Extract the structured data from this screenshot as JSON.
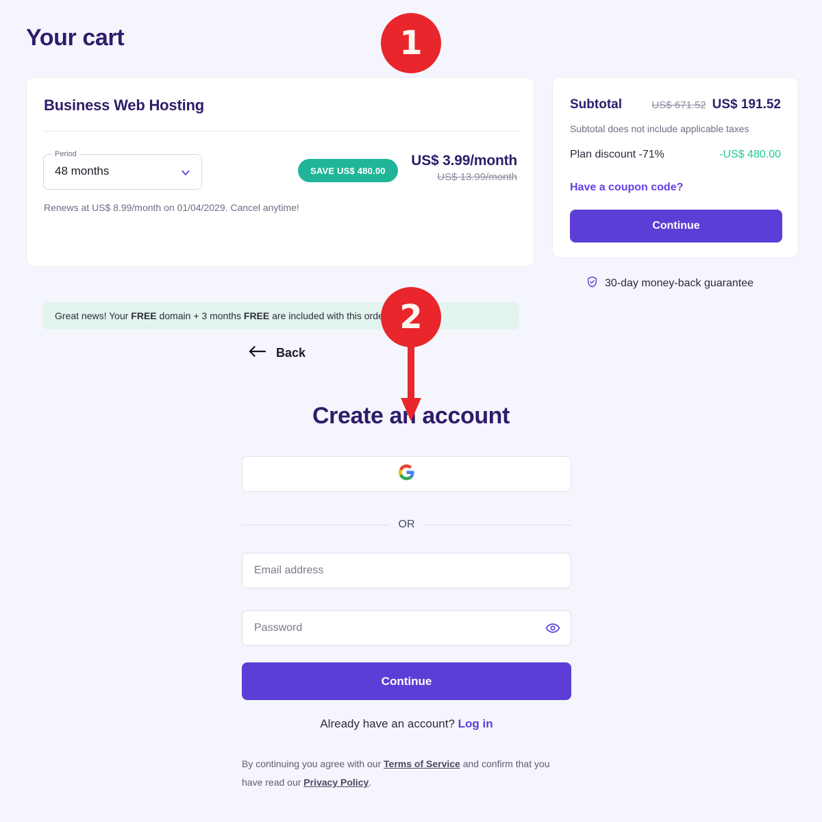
{
  "page": {
    "title": "Your cart",
    "background_color": "#f5f5fd",
    "brand_purple": "#5c3ed6",
    "heading_color": "#2f1c6a",
    "accent_green": "#20b598",
    "marker_red": "#e8262b"
  },
  "annotations": [
    {
      "id": "1",
      "label": "1",
      "shape": "circle"
    },
    {
      "id": "2",
      "label": "2",
      "shape": "circle-with-down-arrow"
    }
  ],
  "cart": {
    "product_title": "Business Web Hosting",
    "period": {
      "legend": "Period",
      "value": "48 months",
      "options": [
        "48 months"
      ]
    },
    "save_badge": "SAVE US$ 480.00",
    "price_now": "US$ 3.99/month",
    "price_old": "US$ 13.99/month",
    "renew_note": "Renews at US$ 8.99/month on 01/04/2029. Cancel anytime!",
    "free_banner": {
      "part1": "Great news! Your ",
      "free1": "FREE",
      "part2": " domain + 3 months ",
      "free2": "FREE",
      "part3": " are included with this order.",
      "help_icon": "question-mark-circle-icon"
    }
  },
  "subtotal": {
    "label": "Subtotal",
    "amount_old": "US$ 671.52",
    "amount_new": "US$ 191.52",
    "tax_note": "Subtotal does not include applicable taxes",
    "discount_label": "Plan discount -71%",
    "discount_value": "-US$ 480.00",
    "coupon_link": "Have a coupon code?",
    "continue_label": "Continue",
    "guarantee_text": "30-day money-back guarantee",
    "guarantee_icon": "shield-check-icon"
  },
  "account": {
    "back_label": "Back",
    "back_icon": "arrow-left-icon",
    "heading": "Create an account",
    "google_button_icon": "google-logo-icon",
    "divider_text": "OR",
    "email_placeholder": "Email address",
    "email_value": "",
    "password_placeholder": "Password",
    "password_value": "",
    "password_toggle_icon": "eye-icon",
    "continue_label": "Continue",
    "already_text": "Already have an account? ",
    "login_link": "Log in",
    "legal": {
      "part1": "By continuing you agree with our ",
      "terms_link": "Terms of Service",
      "part2": " and confirm that you have read our ",
      "privacy_link": "Privacy Policy",
      "part3": "."
    }
  }
}
